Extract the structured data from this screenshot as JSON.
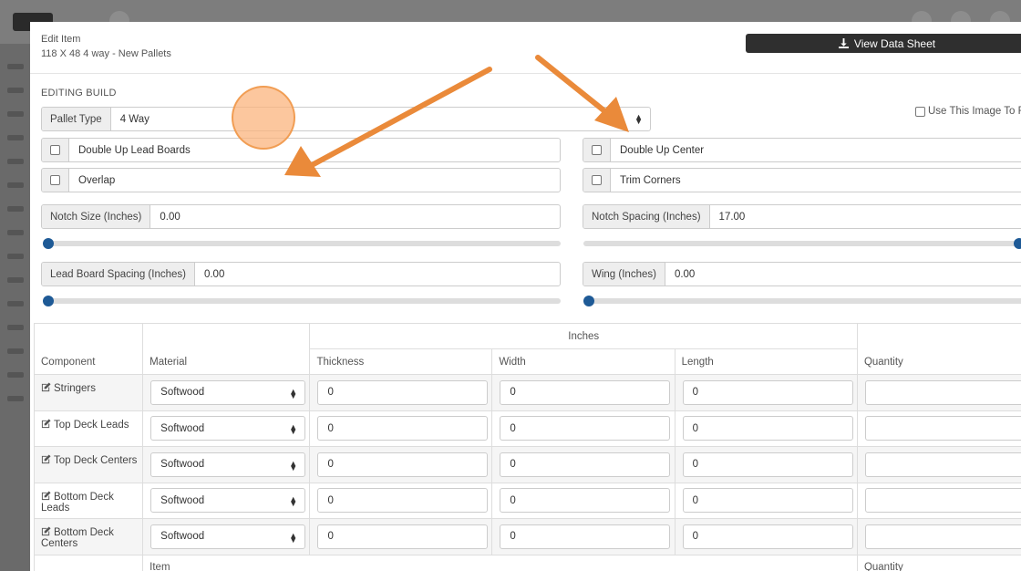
{
  "header": {
    "label": "Edit Item",
    "item_name": "118 X 48 4 way - New Pallets",
    "data_sheet_button": "View Data Sheet"
  },
  "build": {
    "section_title": "EDITING BUILD",
    "pallet_type_label": "Pallet Type",
    "pallet_type_value": "4 Way",
    "use_image_label": "Use This Image To Re",
    "options": {
      "double_up_lead_boards": "Double Up Lead Boards",
      "overlap": "Overlap",
      "double_up_center": "Double Up Center",
      "trim_corners": "Trim Corners"
    },
    "notch_size": {
      "label": "Notch Size (Inches)",
      "value": "0.00",
      "slider_fraction": 0.0
    },
    "notch_spacing": {
      "label": "Notch Spacing (Inches)",
      "value": "17.00",
      "slider_fraction": 1.0
    },
    "lead_board_spacing": {
      "label": "Lead Board Spacing (Inches)",
      "value": "0.00",
      "slider_fraction": 0.0
    },
    "wing": {
      "label": "Wing (Inches)",
      "value": "0.00",
      "slider_fraction": 0.0
    }
  },
  "table": {
    "group_header": "Inches",
    "columns": {
      "component": "Component",
      "material": "Material",
      "thickness": "Thickness",
      "width": "Width",
      "length": "Length",
      "quantity": "Quantity"
    },
    "rows": [
      {
        "component": "Stringers",
        "material": "Softwood",
        "thickness": "0",
        "width": "0",
        "length": "0",
        "quantity": ""
      },
      {
        "component": "Top Deck Leads",
        "material": "Softwood",
        "thickness": "0",
        "width": "0",
        "length": "0",
        "quantity": ""
      },
      {
        "component": "Top Deck Centers",
        "material": "Softwood",
        "thickness": "0",
        "width": "0",
        "length": "0",
        "quantity": ""
      },
      {
        "component": "Bottom Deck Leads",
        "material": "Softwood",
        "thickness": "0",
        "width": "0",
        "length": "0",
        "quantity": ""
      },
      {
        "component": "Bottom Deck Centers",
        "material": "Softwood",
        "thickness": "0",
        "width": "0",
        "length": "0",
        "quantity": ""
      }
    ],
    "footer": {
      "item": "Item",
      "quantity": "Quantity"
    }
  },
  "colors": {
    "accent_button": "#2f2f2f",
    "slider_knob": "#1e5a96",
    "annotation": "#ea8a3a"
  }
}
